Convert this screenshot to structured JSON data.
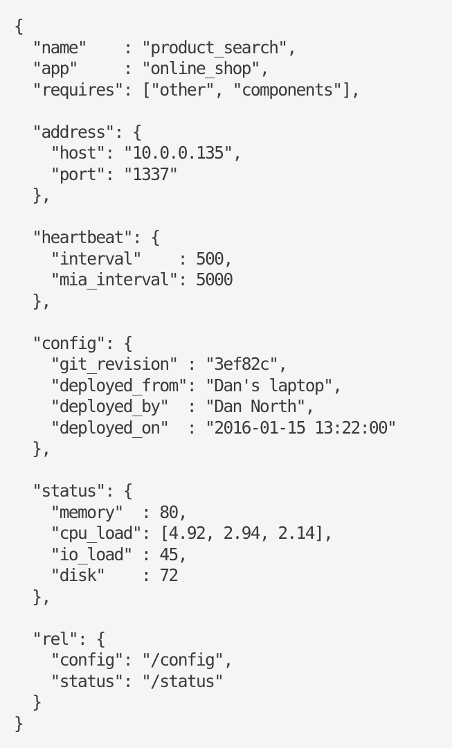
{
  "document": {
    "lines": [
      "{",
      "  \"name\"    : \"product_search\",",
      "  \"app\"     : \"online_shop\",",
      "  \"requires\": [\"other\", \"components\"],",
      "",
      "  \"address\": {",
      "    \"host\": \"10.0.0.135\",",
      "    \"port\": \"1337\"",
      "  },",
      "",
      "  \"heartbeat\": {",
      "    \"interval\"    : 500,",
      "    \"mia_interval\": 5000",
      "  },",
      "",
      "  \"config\": {",
      "    \"git_revision\" : \"3ef82c\",",
      "    \"deployed_from\": \"Dan's laptop\",",
      "    \"deployed_by\"  : \"Dan North\",",
      "    \"deployed_on\"  : \"2016-01-15 13:22:00\"",
      "  },",
      "",
      "  \"status\": {",
      "    \"memory\"  : 80,",
      "    \"cpu_load\": [4.92, 2.94, 2.14],",
      "    \"io_load\" : 45,",
      "    \"disk\"    : 72",
      "  },",
      "",
      "  \"rel\": {",
      "    \"config\": \"/config\",",
      "    \"status\": \"/status\"",
      "  }",
      "}"
    ]
  }
}
